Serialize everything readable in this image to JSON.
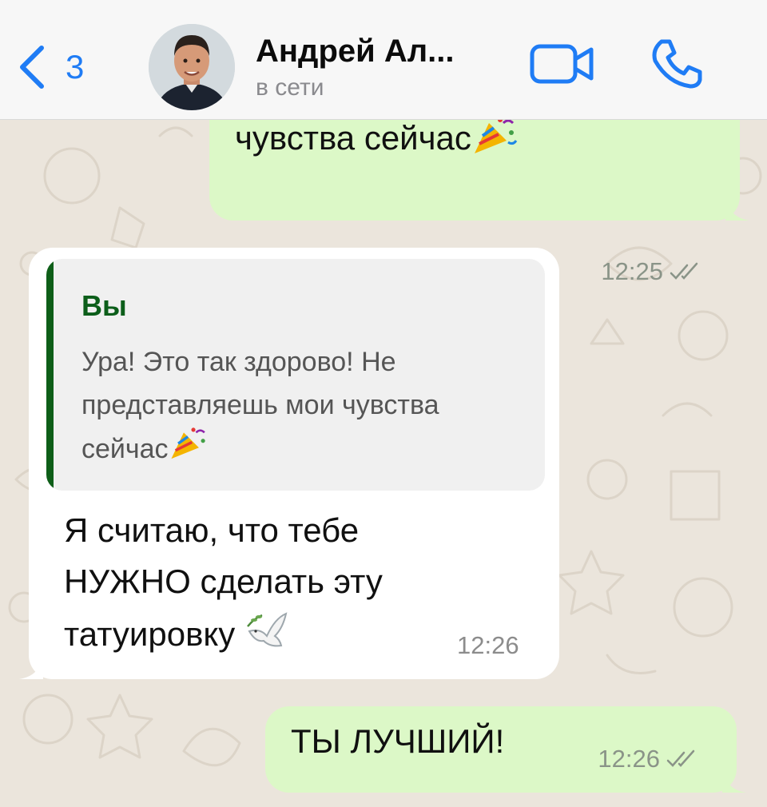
{
  "header": {
    "back_count": "3",
    "contact_name": "Андрей Ал...",
    "status": "в сети",
    "video_icon": "video-camera-icon",
    "call_icon": "phone-icon",
    "back_icon": "chevron-left-icon",
    "accent_color": "#1f7cf5"
  },
  "messages": [
    {
      "direction": "outgoing",
      "text": "чувства сейчас",
      "emoji": "party-popper",
      "time": "12:25",
      "read": true
    },
    {
      "direction": "incoming",
      "quote": {
        "author": "Вы",
        "text": "Ура! Это так здорово! Не представляешь мои чувства сейчас"
      },
      "text": "Я считаю, что тебе НУЖНО сделать эту татуировку",
      "emoji": "dove",
      "time": "12:26"
    },
    {
      "direction": "outgoing",
      "text": "ТЫ ЛУЧШИЙ!",
      "time": "12:26",
      "read": true
    }
  ],
  "colors": {
    "outgoing_bubble": "#dcf8c7",
    "incoming_bubble": "#ffffff",
    "quote_bar": "#0e5e18",
    "wallpaper": "#ebe5dc"
  }
}
